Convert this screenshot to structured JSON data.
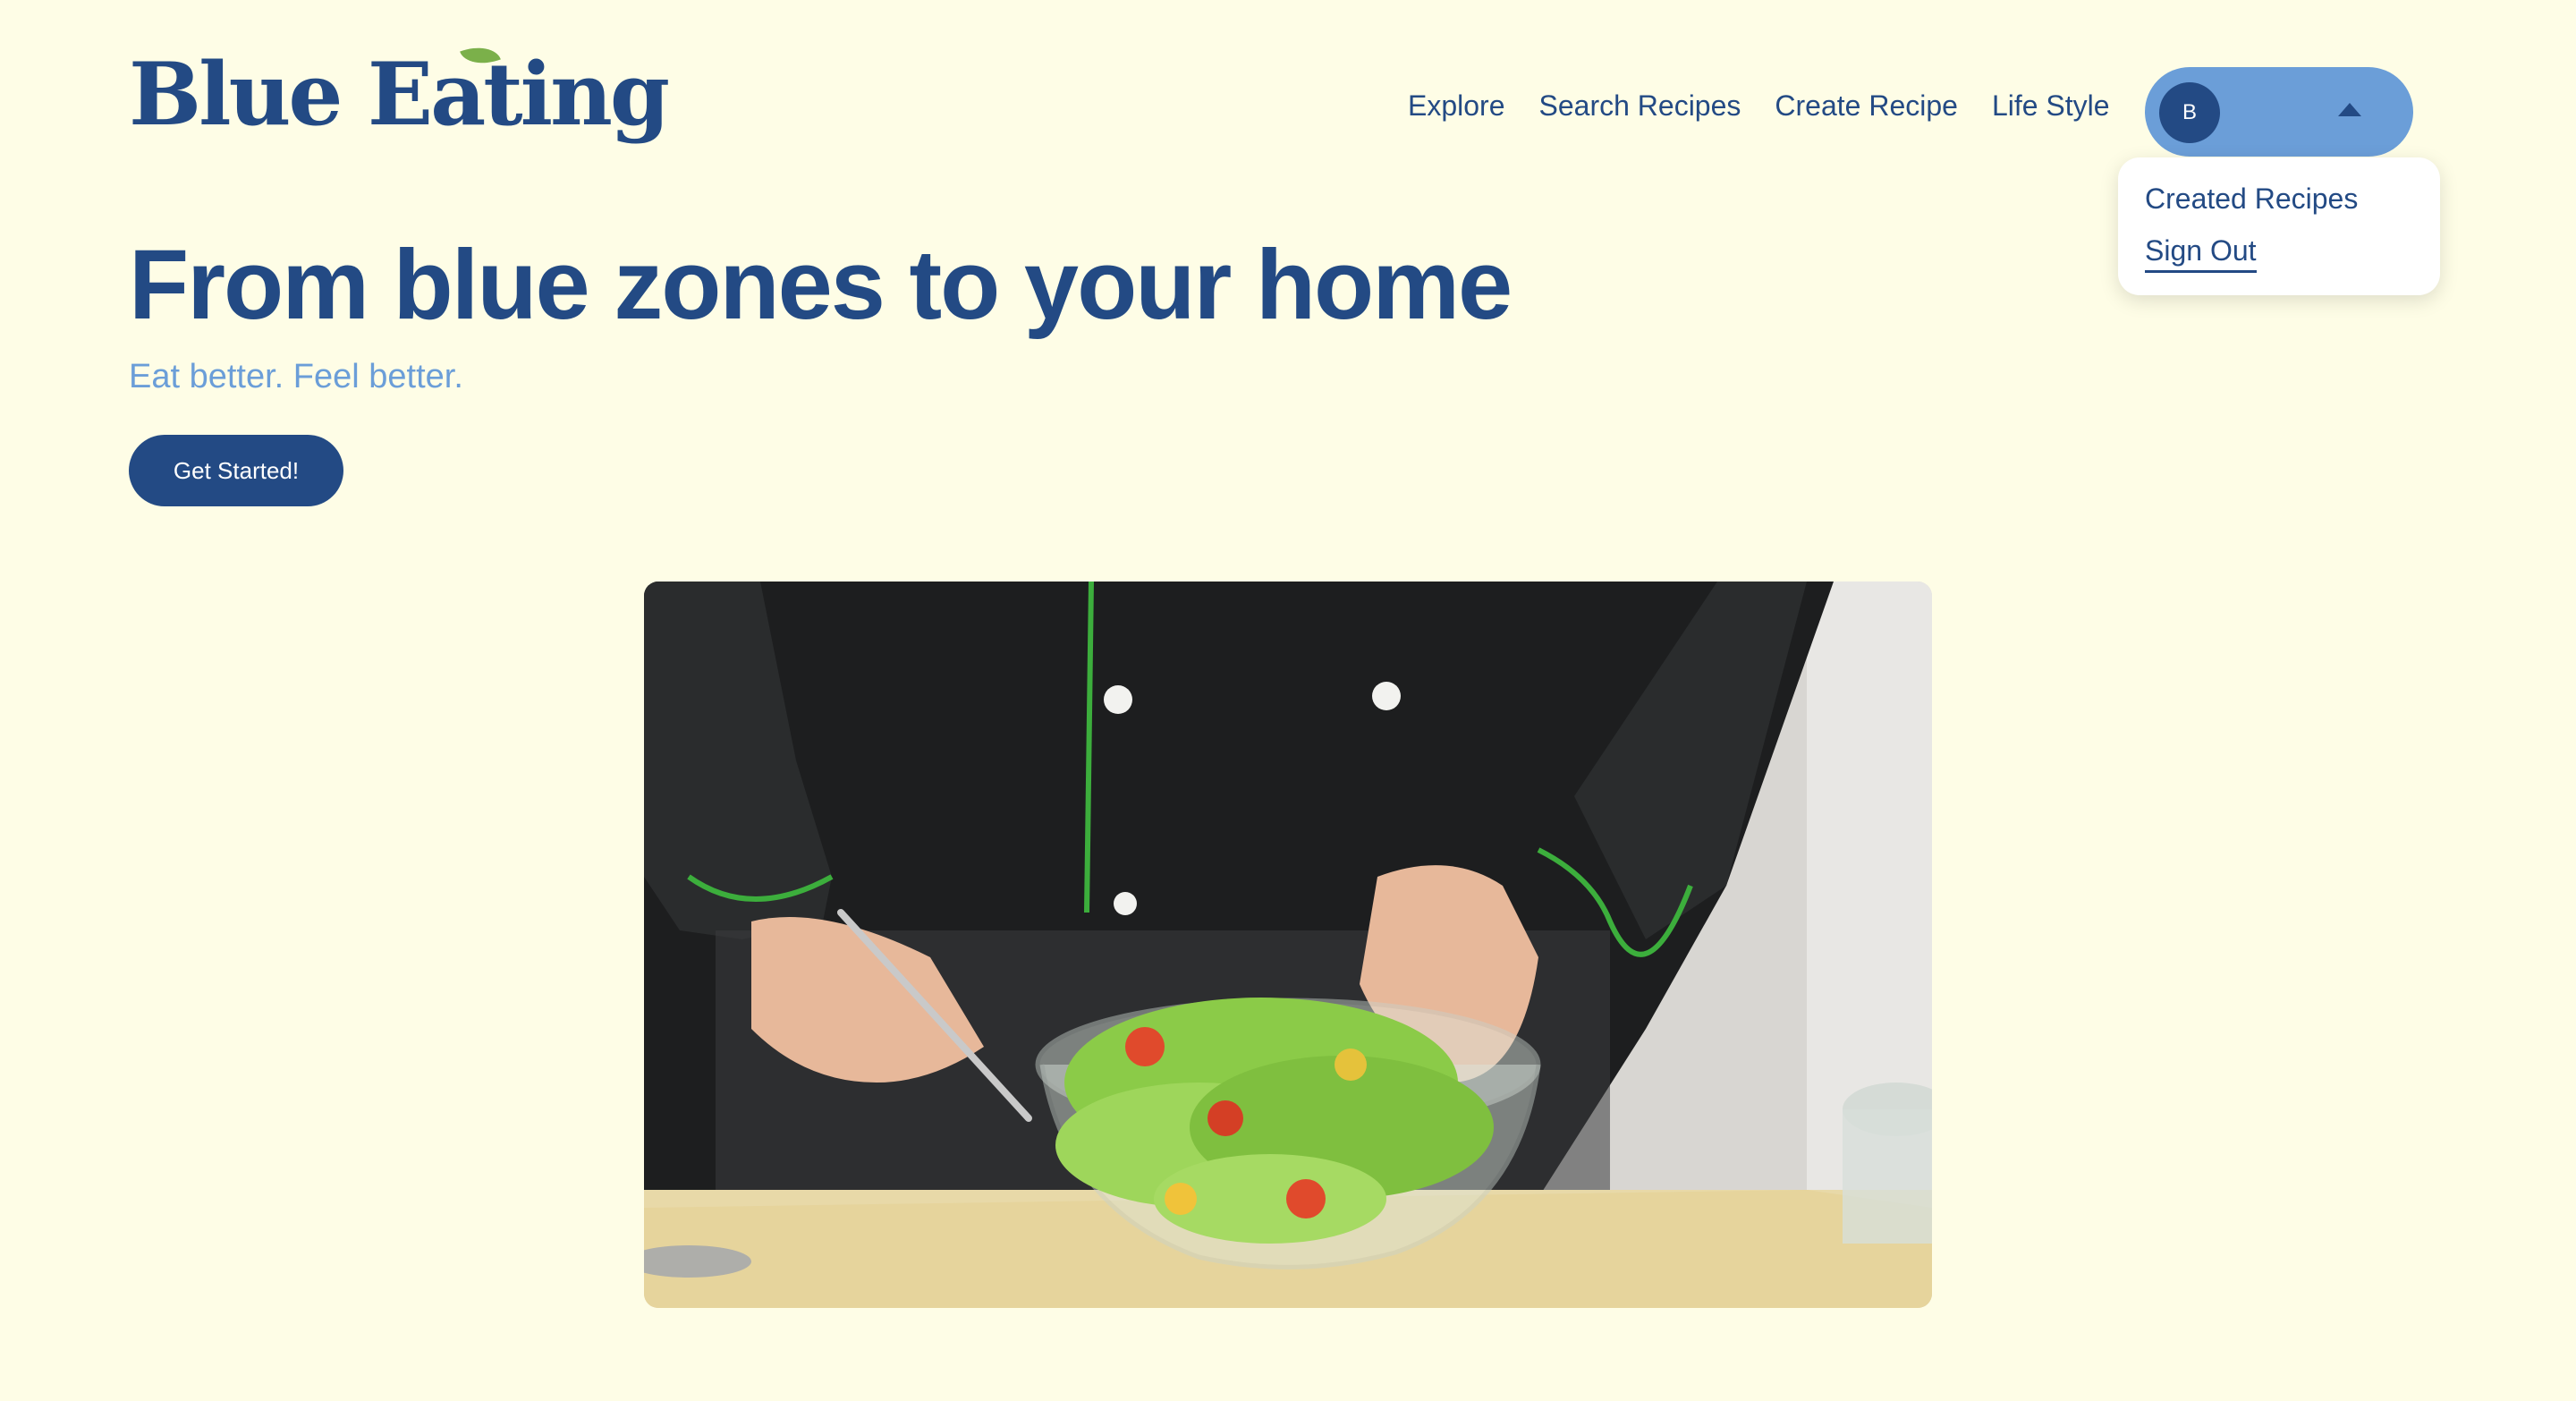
{
  "brand": {
    "name": "Blue Eating"
  },
  "nav": {
    "explore": "Explore",
    "search_recipes": "Search Recipes",
    "create_recipe": "Create Recipe",
    "life_style": "Life Style"
  },
  "user_menu": {
    "avatar_initial": "B",
    "toggle_icon": "caret-up-icon",
    "items": {
      "created_recipes": "Created Recipes",
      "sign_out": "Sign Out"
    }
  },
  "hero": {
    "title": "From blue zones to your home",
    "subtitle": "Eat better. Feel better.",
    "cta_label": "Get Started!"
  },
  "colors": {
    "background": "#fefde6",
    "primary": "#234a84",
    "accent": "#6b9ed8",
    "leaf": "#7bb04a"
  }
}
